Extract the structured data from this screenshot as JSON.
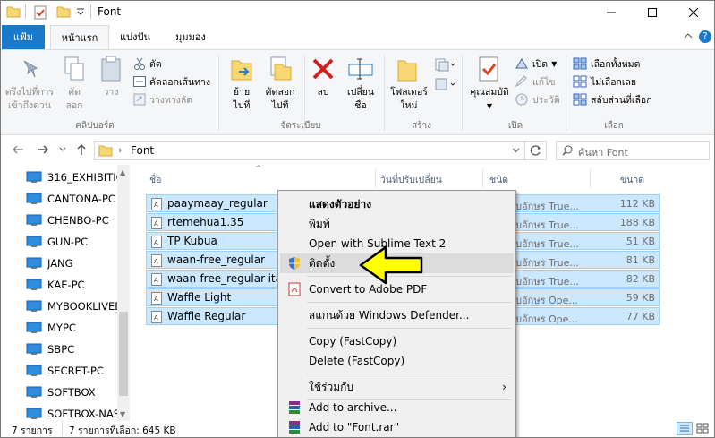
{
  "window": {
    "title": "Font"
  },
  "ribbon_tabs": {
    "file": "แฟ้ม",
    "home": "หน้าแรก",
    "share": "แบ่งปัน",
    "view": "มุมมอง"
  },
  "ribbon": {
    "pin": [
      "ตรึงไปที่การ",
      "เข้าถึงด่วน"
    ],
    "copy": [
      "คัด",
      "ลอก"
    ],
    "paste": "วาง",
    "cut": "ตัด",
    "copy_path": "คัดลอกเส้นทาง",
    "paste_shortcut": "วางทางลัด",
    "group_clipboard": "คลิปบอร์ด",
    "move_to": [
      "ย้าย",
      "ไปที่"
    ],
    "copy_to": [
      "คัดลอก",
      "ไปที่"
    ],
    "delete": "ลบ",
    "rename": [
      "เปลี่ยน",
      "ชื่อ"
    ],
    "group_organize": "จัดระเบียบ",
    "new_folder": [
      "โฟลเดอร์",
      "ใหม่"
    ],
    "group_new": "สร้าง",
    "properties": "คุณสมบัติ",
    "open": "เปิด",
    "edit": "แก้ไข",
    "history": "ประวัติ",
    "group_open": "เปิด",
    "select_all": "เลือกทั้งหมด",
    "select_none": "ไม่เลือกเลย",
    "invert_selection": "สลับส่วนที่เลือก",
    "group_select": "เลือก"
  },
  "address": {
    "path": "Font",
    "search_placeholder": "ค้นหา Font"
  },
  "nav_items": [
    "316_EXHIBITIO",
    "CANTONA-PC",
    "CHENBO-PC",
    "GUN-PC",
    "JANG",
    "KAE-PC",
    "MYBOOKLIVED",
    "MYPC",
    "SBPC",
    "SECRET-PC",
    "SOFTBOX",
    "SOFTBOX-NAS"
  ],
  "columns": {
    "name": "ชื่อ",
    "date": "วันที่ปรับเปลี่ยน",
    "type": "ชนิด",
    "size": "ขนาด"
  },
  "files": [
    {
      "name": "paaymaay_regular",
      "type": "แบบอักษร True...",
      "size": "112 KB"
    },
    {
      "name": "rtemehua1.35",
      "type": "แบบอักษร True...",
      "size": "188 KB"
    },
    {
      "name": "TP Kubua",
      "type": "แบบอักษร True...",
      "size": "51 KB"
    },
    {
      "name": "waan-free_regular",
      "type": "แบบอักษร True...",
      "size": "81 KB"
    },
    {
      "name": "waan-free_regular-italic",
      "type": "แบบอักษร True...",
      "size": "82 KB"
    },
    {
      "name": "Waffle Light",
      "type": "แบบอักษร Ope...",
      "size": "59 KB"
    },
    {
      "name": "Waffle Regular",
      "type": "แบบอักษร Ope...",
      "size": "77 KB"
    }
  ],
  "context_menu": {
    "preview": "แสดงตัวอย่าง",
    "print": "พิมพ์",
    "open_sublime": "Open with Sublime Text 2",
    "install": "ติดตั้ง",
    "convert_pdf": "Convert to Adobe PDF",
    "defender": "สแกนด้วย Windows Defender...",
    "copy_fastcopy": "Copy  (FastCopy)",
    "delete_fastcopy": "Delete (FastCopy)",
    "share_with": "ใช้ร่วมกับ",
    "add_archive": "Add to archive...",
    "add_rar": "Add to \"Font.rar\""
  },
  "status": {
    "items": "7 รายการ",
    "selected": "7 รายการที่เลือก: 645 KB"
  },
  "colors": {
    "accent": "#1979ca",
    "selection": "#cce8ff",
    "arrow": "#ffff00"
  }
}
